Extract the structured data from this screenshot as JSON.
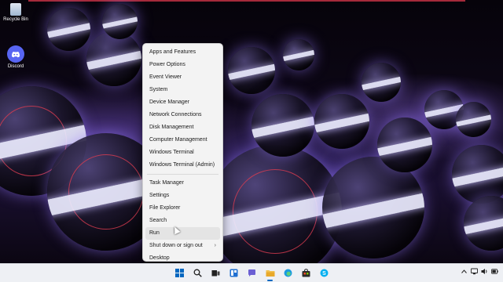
{
  "desktop": {
    "icons": [
      {
        "label": "Recycle Bin",
        "icon": "recycle-bin-icon"
      },
      {
        "label": "Discord",
        "icon": "discord-icon"
      }
    ]
  },
  "context_menu": {
    "groups": [
      [
        "Apps and Features",
        "Power Options",
        "Event Viewer",
        "System",
        "Device Manager",
        "Network Connections",
        "Disk Management",
        "Computer Management",
        "Windows Terminal",
        "Windows Terminal (Admin)"
      ],
      [
        "Task Manager",
        "Settings",
        "File Explorer",
        "Search",
        "Run",
        "Shut down or sign out",
        "Desktop"
      ]
    ],
    "hovered_item": "Run",
    "submenu_item": "Shut down or sign out"
  },
  "taskbar": {
    "pinned": [
      {
        "name": "start-icon",
        "color": "#0067c0"
      },
      {
        "name": "search-icon",
        "color": "#222222"
      },
      {
        "name": "task-view-icon",
        "color": "#222222"
      },
      {
        "name": "widgets-icon",
        "color": "#1f6fd1"
      },
      {
        "name": "chat-icon",
        "color": "#6b5fd3"
      },
      {
        "name": "file-explorer-icon",
        "color": "#f2c14e"
      },
      {
        "name": "edge-icon",
        "color": "#1a9be0"
      },
      {
        "name": "store-icon",
        "color": "#2b2b2b"
      },
      {
        "name": "skype-icon",
        "color": "#00aff0"
      }
    ],
    "tray": [
      "chevron-up-icon",
      "network-icon",
      "volume-icon",
      "battery-icon"
    ]
  },
  "colors": {
    "menu_bg": "#f3f3f3",
    "taskbar_bg": "#eef0f4",
    "accent": "#0067c0"
  }
}
